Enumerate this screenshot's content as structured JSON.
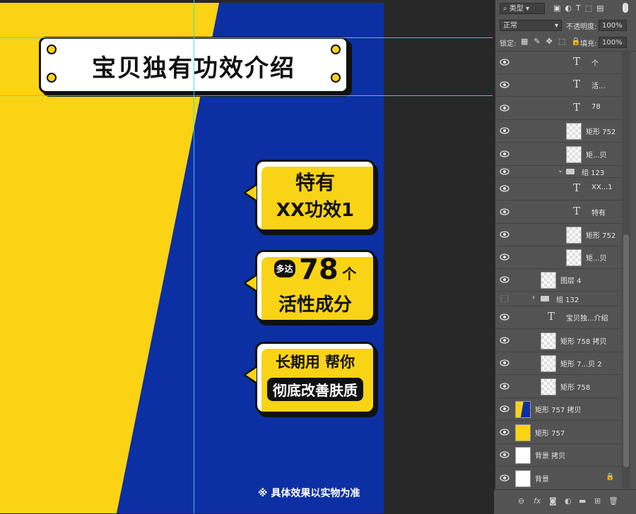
{
  "canvas": {
    "colors": {
      "blue": "#0c2fa3",
      "yellow": "#fbd315",
      "dark": "#111111"
    },
    "title": "宝贝独有功效介绍",
    "bubble1": {
      "line1": "特有",
      "line2": "XX功效1"
    },
    "bubble2": {
      "badge": "多达",
      "number": "78",
      "unit": "个",
      "line2": "活性成分"
    },
    "bubble3": {
      "line1": "长期用 帮你",
      "line2": "彻底改善肤质"
    },
    "note": "※ 具体效果以实物为准"
  },
  "panel": {
    "filter_kind": "类型",
    "blend_mode": "正常",
    "opacity_label": "不透明度:",
    "opacity_value": "100%",
    "lock_label": "锁定:",
    "fill_label": "填充:",
    "fill_value": "100%",
    "icons": [
      "image-filter-icon",
      "adjustment-filter-icon",
      "text-filter-icon",
      "shape-filter-icon",
      "smart-object-filter-icon",
      "filter-toggle-icon"
    ],
    "layers": [
      {
        "name": "个",
        "kind": "text",
        "indent": 1
      },
      {
        "name": "活...",
        "kind": "text",
        "indent": 1
      },
      {
        "name": "78",
        "kind": "text",
        "indent": 1
      },
      {
        "name": "矩形 752",
        "kind": "shape",
        "indent": 1
      },
      {
        "name": "矩...贝",
        "kind": "shape",
        "indent": 1
      },
      {
        "name": "组 123",
        "kind": "group",
        "indent": 1
      },
      {
        "name": "XX...1",
        "kind": "text",
        "indent": 1
      },
      {
        "name": "特有",
        "kind": "text",
        "indent": 1
      },
      {
        "name": "矩形 752",
        "kind": "shape",
        "indent": 1
      },
      {
        "name": "矩...贝",
        "kind": "shape",
        "indent": 1
      },
      {
        "name": "图层 4",
        "kind": "pixel",
        "indent": 0
      },
      {
        "name": "组 132",
        "kind": "group-closed",
        "indent": 0
      },
      {
        "name": "宝贝独...介绍",
        "kind": "text",
        "indent": 0
      },
      {
        "name": "矩形 758 拷贝",
        "kind": "shape",
        "indent": 0
      },
      {
        "name": "矩形 7...贝 2",
        "kind": "shape",
        "indent": 0
      },
      {
        "name": "矩形 758",
        "kind": "shape",
        "indent": 0
      },
      {
        "name": "矩形 757 拷贝",
        "kind": "shape-blue",
        "indent": -1
      },
      {
        "name": "矩形 757",
        "kind": "shape-yellow",
        "indent": -1
      },
      {
        "name": "背景 拷贝",
        "kind": "white",
        "indent": -1
      },
      {
        "name": "背景",
        "kind": "white-locked",
        "indent": -1
      }
    ],
    "footer_icons": [
      "link-icon",
      "fx-icon",
      "mask-icon",
      "adjustment-icon",
      "group-icon",
      "new-layer-icon",
      "delete-icon"
    ]
  }
}
